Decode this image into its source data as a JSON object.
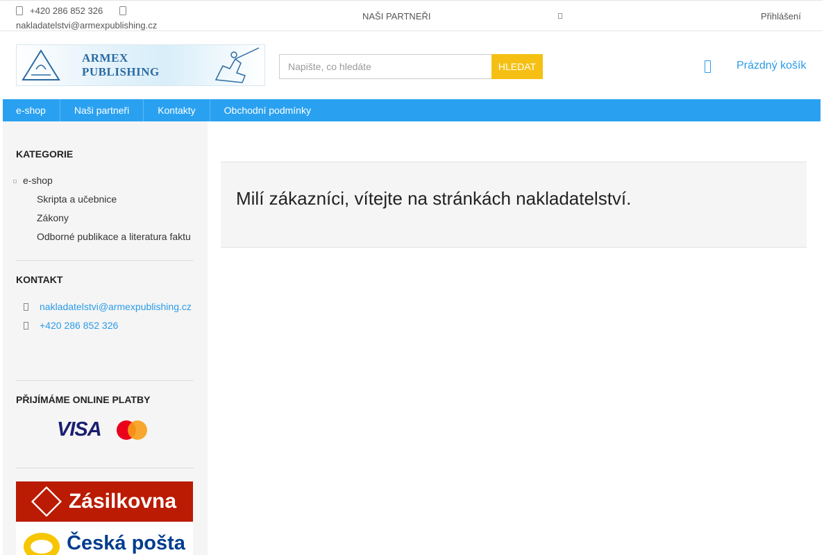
{
  "topbar": {
    "phone": "+420 286 852 326",
    "email": "nakladatelstvi@armexpublishing.cz",
    "partners_label": "NAŠI PARTNEŘI",
    "login_label": "Přihlášení"
  },
  "header": {
    "logo_text": "ARMEX PUBLISHING",
    "search_placeholder": "Napište, co hledáte",
    "search_button": "HLEDAT",
    "cart_label": "Prázdný košík"
  },
  "nav": {
    "items": [
      {
        "label": "e-shop"
      },
      {
        "label": "Naši partneři"
      },
      {
        "label": "Kontakty"
      },
      {
        "label": "Obchodní podmínky"
      }
    ]
  },
  "sidebar": {
    "categories_title": "KATEGORIE",
    "categories": [
      {
        "label": "e-shop",
        "level": "top"
      },
      {
        "label": "Skripta a učebnice",
        "level": "sub"
      },
      {
        "label": "Zákony",
        "level": "sub"
      },
      {
        "label": "Odborné publikace a literatura faktu",
        "level": "sub"
      }
    ],
    "contact_title": "KONTAKT",
    "contact_email": "nakladatelstvi@armexpublishing.cz",
    "contact_phone": "+420 286 852 326",
    "payments_title": "PŘIJÍMÁME ONLINE PLATBY",
    "visa_label": "VISA",
    "zasilkovna_label": "Zásilkovna",
    "posta_label": "Česká pošta"
  },
  "main": {
    "welcome": "Milí zákazníci, vítejte na stránkách nakladatelství."
  },
  "colors": {
    "accent": "#2aa1f0",
    "search_button": "#f5c013",
    "link": "#2a9be8"
  }
}
